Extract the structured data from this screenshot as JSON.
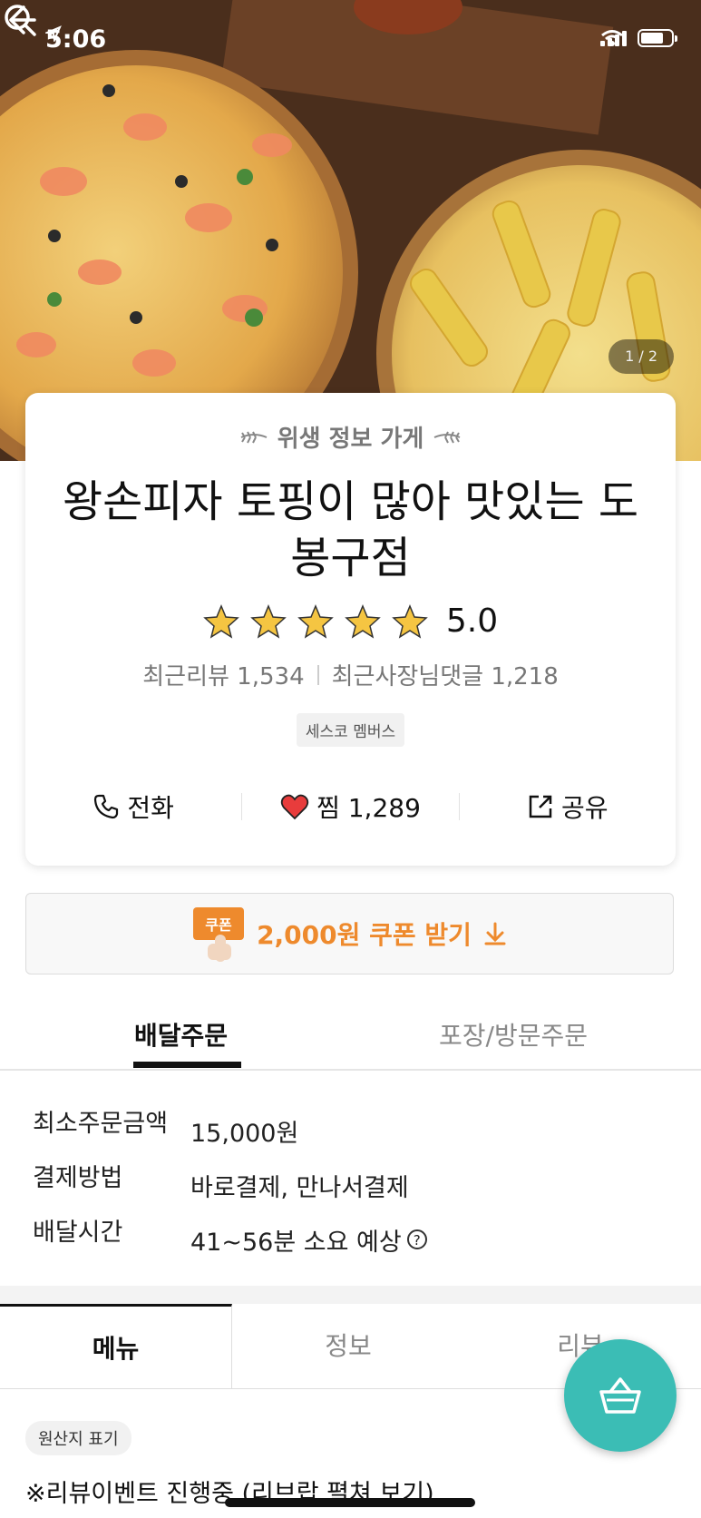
{
  "status_bar": {
    "time": "5:06"
  },
  "hero": {
    "page_indicator": "1 / 2"
  },
  "store": {
    "hygiene_label": "위생 정보 가게",
    "name": "왕손피자 토핑이 많아 맛있는 도봉구점",
    "rating": 5.0,
    "rating_text": "5.0",
    "recent_reviews": "최근리뷰 1,534",
    "recent_owner_replies": "최근사장님댓글 1,218",
    "badge": "세스코 멤버스"
  },
  "actions": {
    "call": "전화",
    "favorite": "찜 1,289",
    "share": "공유"
  },
  "coupon": {
    "icon_text": "쿠폰",
    "label": "2,000원 쿠폰 받기"
  },
  "order_tabs": {
    "delivery": "배달주문",
    "pickup": "포장/방문주문"
  },
  "order_info": {
    "min_order_label": "최소주문금액",
    "min_order_value": "15,000원",
    "payment_label": "결제방법",
    "payment_value": "바로결제, 만나서결제",
    "delivery_time_label": "배달시간",
    "delivery_time_value": "41~56분 소요 예상",
    "help_glyph": "?"
  },
  "content_tabs": {
    "menu": "메뉴",
    "info": "정보",
    "review": "리뷰"
  },
  "origin_label": "원산지 표기",
  "event_text": "※리뷰이벤트 진행중 (리브랍 펼쳐 보기)",
  "colors": {
    "accent": "#ee8a2d",
    "cart": "#3bbdb5",
    "heart": "#e83c3c",
    "star": "#f5c542"
  }
}
